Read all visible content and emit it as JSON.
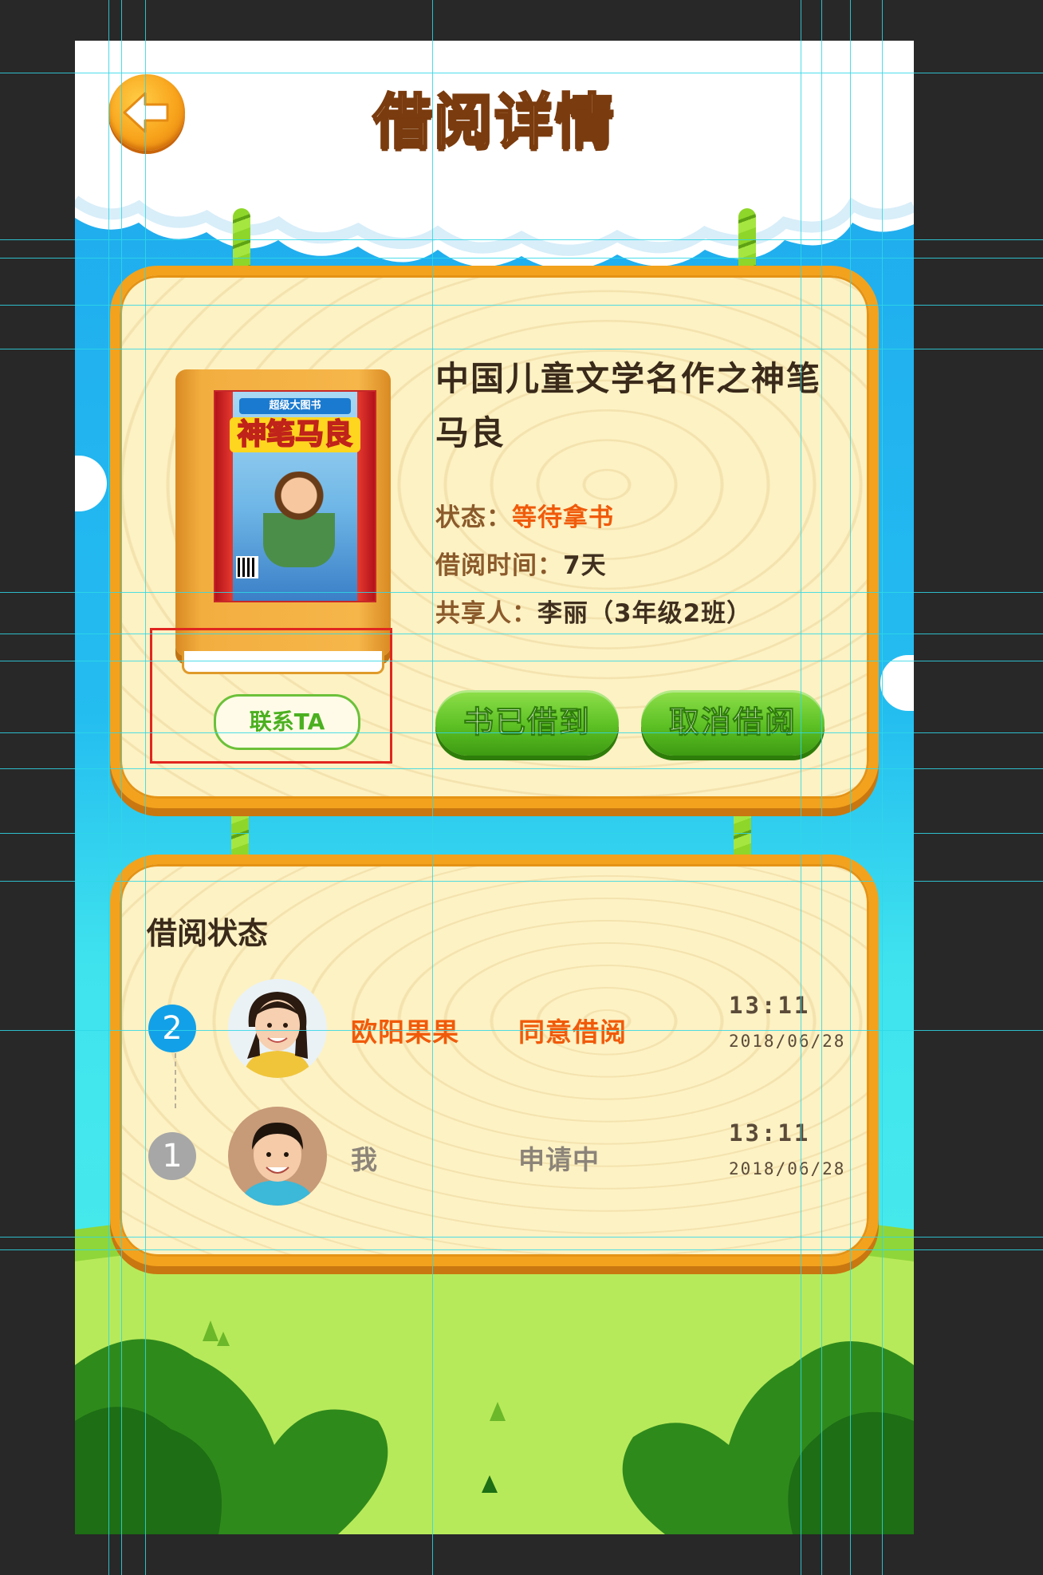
{
  "header": {
    "title": "借阅详情",
    "back_icon": "arrow-left-icon"
  },
  "book": {
    "title": "中国儿童文学名作之神笔马良",
    "cover": {
      "series": "超级大图书",
      "title": "神笔马良"
    },
    "status_label": "状态：",
    "status_value": "等待拿书",
    "borrow_time_label": "借阅时间：",
    "borrow_time_value": "7天",
    "sharer_label": "共享人：",
    "sharer_value": "李丽（3年级2班）",
    "contact_button": "联系TA",
    "received_button": "书已借到",
    "cancel_button": "取消借阅"
  },
  "borrow_status": {
    "title": "借阅状态",
    "records": [
      {
        "step": "2",
        "name": "欧阳果果",
        "status": "同意借阅",
        "time": "13:11",
        "date": "2018/06/28",
        "active": true
      },
      {
        "step": "1",
        "name": "我",
        "status": "申请中",
        "time": "13:11",
        "date": "2018/06/28",
        "active": false
      }
    ]
  },
  "colors": {
    "accent_orange": "#f05a0a",
    "button_green": "#5cc024",
    "board_frame": "#f2a21d",
    "step_active": "#12a1e8",
    "step_inactive": "#a7a7a7"
  }
}
